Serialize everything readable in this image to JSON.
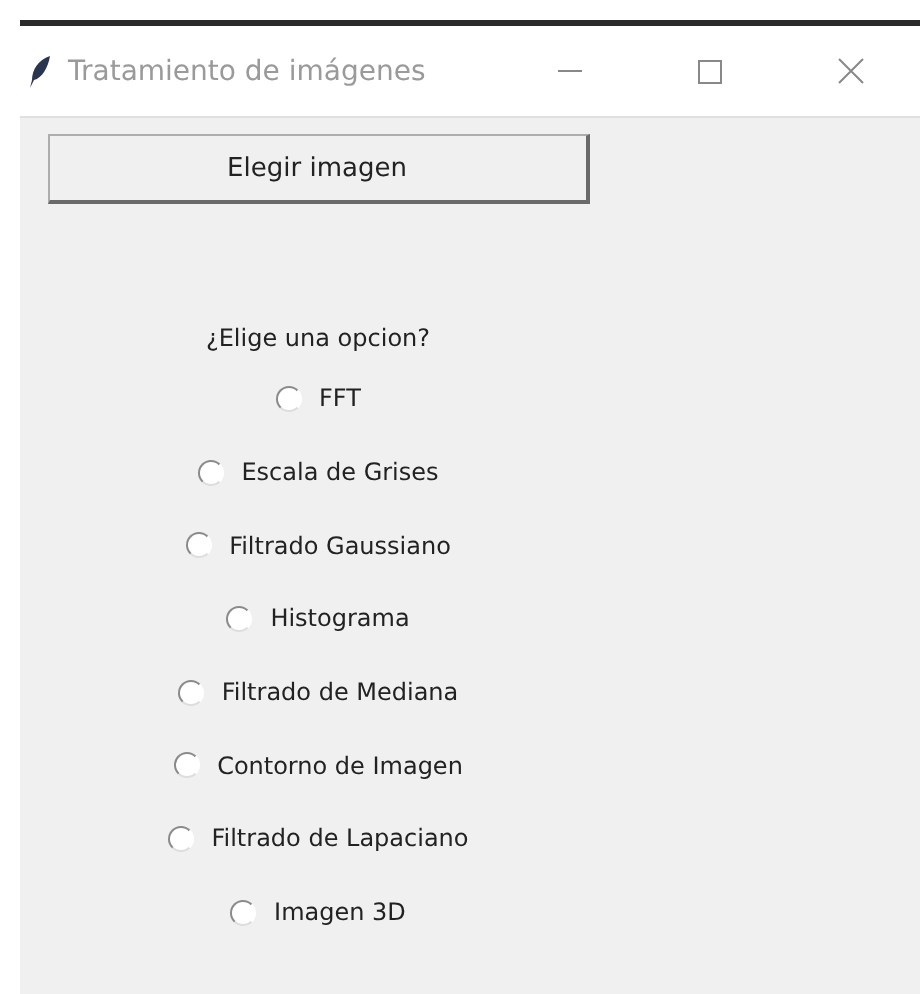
{
  "window": {
    "title": "Tratamiento de imágenes"
  },
  "button": "Elegir imagen",
  "question": "¿Elige una opcion?",
  "options": [
    {
      "label": "FFT",
      "selected": false
    },
    {
      "label": "Escala de Grises",
      "selected": false
    },
    {
      "label": "Filtrado Gaussiano",
      "selected": false
    },
    {
      "label": "Histograma",
      "selected": false
    },
    {
      "label": "Filtrado de Mediana",
      "selected": false
    },
    {
      "label": "Contorno de Imagen",
      "selected": false
    },
    {
      "label": "Filtrado de Lapaciano",
      "selected": false
    },
    {
      "label": "Imagen 3D",
      "selected": false
    }
  ]
}
